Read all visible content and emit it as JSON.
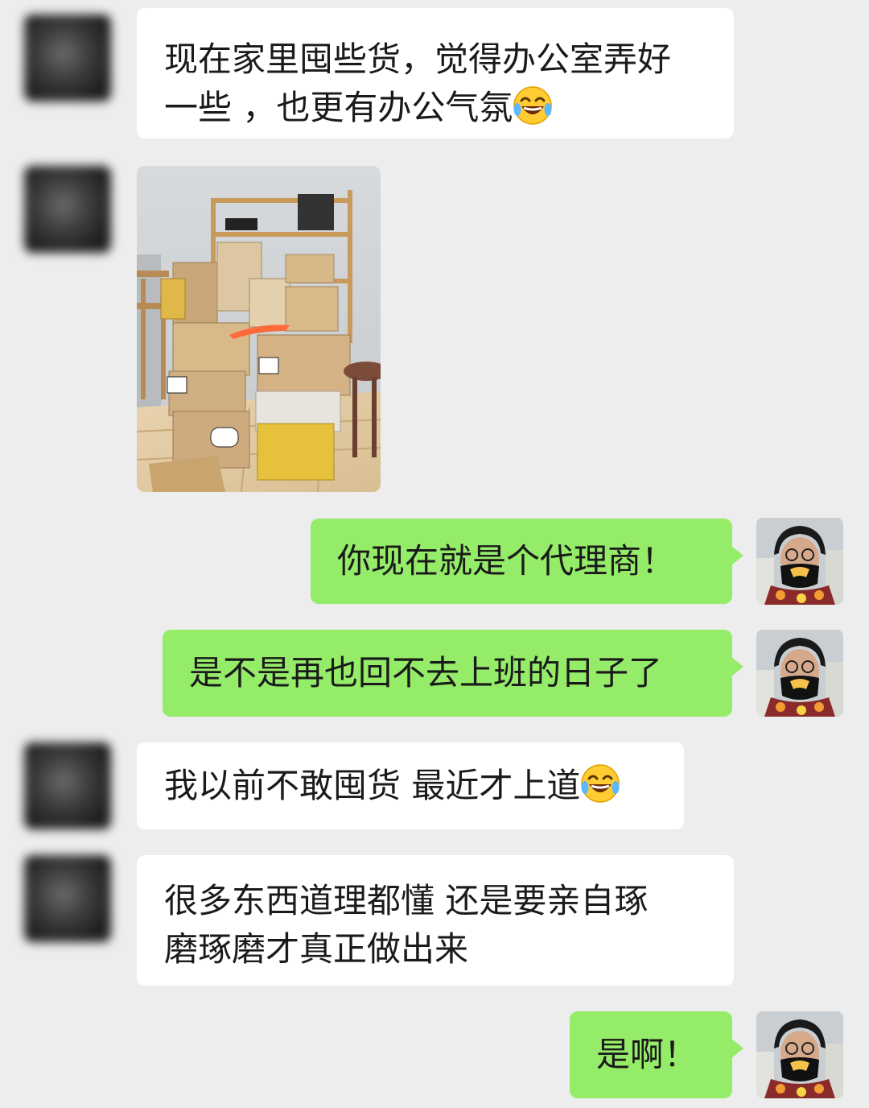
{
  "messages": [
    {
      "side": "left",
      "text": "现在家里囤些货，觉得办公室弄好\n一些 ，也更有办公气氛",
      "emoji": "face-with-tears-of-joy"
    },
    {
      "side": "left",
      "type": "image",
      "image": "boxes-on-shelf-photo"
    },
    {
      "side": "right",
      "text": "你现在就是个代理商！"
    },
    {
      "side": "right",
      "text": "是不是再也回不去上班的日子了"
    },
    {
      "side": "left",
      "text": "我以前不敢囤货 最近才上道",
      "emoji": "face-with-tears-of-joy"
    },
    {
      "side": "left",
      "text": "很多东西道理都懂 还是要亲自琢\n磨琢磨才真正做出来"
    },
    {
      "side": "right",
      "text": "是啊！"
    }
  ],
  "colors": {
    "background": "#ededed",
    "left_bubble": "#ffffff",
    "right_bubble": "#95ec69",
    "text": "#1a1a1a"
  }
}
